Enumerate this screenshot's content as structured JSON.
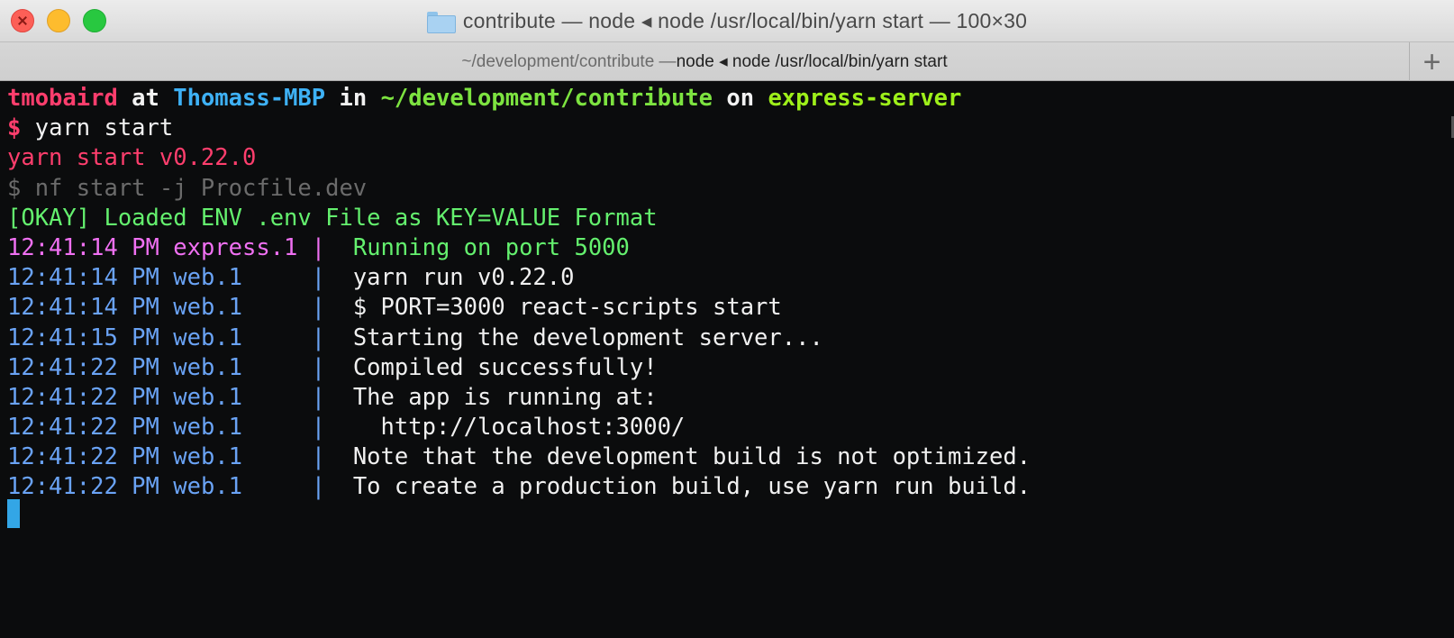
{
  "window": {
    "title": "contribute — node ◂ node /usr/local/bin/yarn start — 100×30",
    "tab_dim": "~/development/contribute — ",
    "tab_main": "node ◂ node /usr/local/bin/yarn start",
    "add_tab_label": "+"
  },
  "prompt": {
    "user": "tmobaird",
    "at": " at ",
    "host": "Thomass-MBP",
    "in": " in ",
    "path": "~/development/contribute",
    "on": " on ",
    "branch": "express-server"
  },
  "command": {
    "symbol": "$",
    "text": " yarn start"
  },
  "output": {
    "yarn_version": "yarn start v0.22.0",
    "nf_cmd": "$ nf start -j Procfile.dev",
    "okay": "[OKAY] Loaded ENV .env File as KEY=VALUE Format",
    "express_line": {
      "time": "12:41:14 PM",
      "proc": " express.1 | ",
      "msg": " Running on port 5000"
    },
    "web_lines": [
      {
        "time": "12:41:14 PM",
        "proc": " web.1     |  ",
        "msg": "yarn run v0.22.0"
      },
      {
        "time": "12:41:14 PM",
        "proc": " web.1     |  ",
        "msg": "$ PORT=3000 react-scripts start"
      },
      {
        "time": "12:41:15 PM",
        "proc": " web.1     |  ",
        "msg": "Starting the development server..."
      },
      {
        "time": "12:41:22 PM",
        "proc": " web.1     |  ",
        "msg": "Compiled successfully!"
      },
      {
        "time": "12:41:22 PM",
        "proc": " web.1     |  ",
        "msg": "The app is running at:"
      },
      {
        "time": "12:41:22 PM",
        "proc": " web.1     |  ",
        "msg": "  http://localhost:3000/"
      },
      {
        "time": "12:41:22 PM",
        "proc": " web.1     |  ",
        "msg": "Note that the development build is not optimized."
      },
      {
        "time": "12:41:22 PM",
        "proc": " web.1     |  ",
        "msg": "To create a production build, use yarn run build."
      }
    ]
  },
  "colors": {
    "pink": "#ff3e6d",
    "blue": "#3eb1f5",
    "green": "#7de340",
    "magenta": "#f070f2",
    "web_blue": "#6aa3f5",
    "cursor": "#33a6e6"
  }
}
